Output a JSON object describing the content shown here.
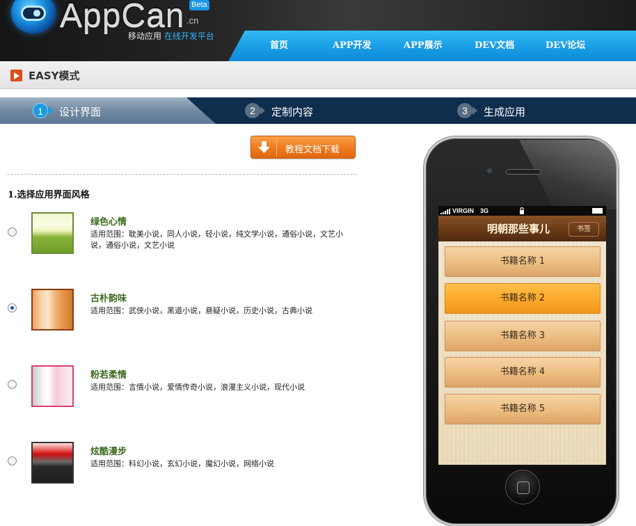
{
  "header": {
    "logo_text": "AppCan",
    "logo_suffix": ".cn",
    "logo_badge": "Beta",
    "tagline_prefix": "移动应用",
    "tagline_highlight": "在线开发平台",
    "nav": [
      "首页",
      "APP开发",
      "APP展示",
      "DEV文档",
      "DEV论坛"
    ]
  },
  "mode": {
    "title": "EASY模式"
  },
  "steps": [
    {
      "num": "1",
      "label": "设计界面"
    },
    {
      "num": "2",
      "label": "定制内容"
    },
    {
      "num": "3",
      "label": "生成应用"
    }
  ],
  "download_button": {
    "label": "教程文档下载"
  },
  "section_title": "1.选择应用界面风格",
  "styles": [
    {
      "title": "绿色心情",
      "desc": "适用范围：耽美小说，同人小说，轻小说，纯文学小说，通俗小说，文艺小说，通俗小说，文艺小说",
      "selected": false
    },
    {
      "title": "古朴韵味",
      "desc": "适用范围：武侠小说，黑道小说，悬疑小说，历史小说，古典小说",
      "selected": true
    },
    {
      "title": "粉若柔情",
      "desc": "适用范围：言情小说，爱情传奇小说，浪漫主义小说，现代小说",
      "selected": false
    },
    {
      "title": "炫酷漫步",
      "desc": "适用范围：科幻小说，玄幻小说，魔幻小说，网络小说",
      "selected": false
    }
  ],
  "phone": {
    "carrier": "VIRGIN",
    "network": "3G",
    "app_title": "明朝那些事儿",
    "app_tab": "书签",
    "books": [
      "书籍名称 1",
      "书籍名称 2",
      "书籍名称 3",
      "书籍名称 4",
      "书籍名称 5"
    ],
    "selected_book": 2
  },
  "colors": {
    "nav_blue": "#1a9fe6",
    "step_bar": "#0f2d4d",
    "accent_orange": "#ee7a1e",
    "style_title_green": "#3c6a1c"
  }
}
